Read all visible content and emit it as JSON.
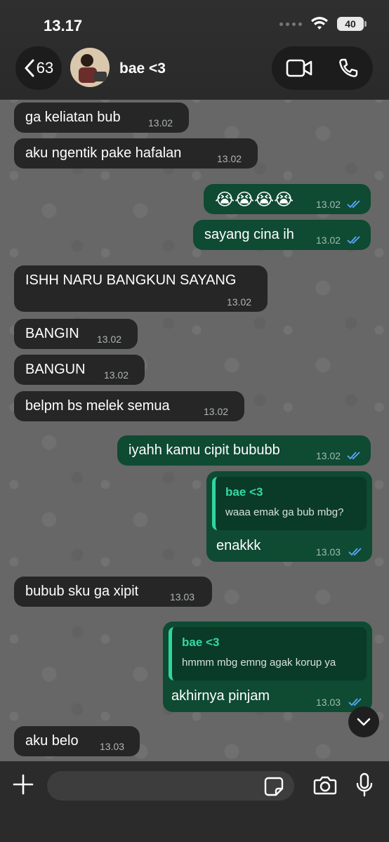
{
  "status": {
    "time": "13.17",
    "battery": "40"
  },
  "header": {
    "back_count": "63",
    "chat_name": "bae <3"
  },
  "messages": [
    {
      "text": "ga keliatan bub",
      "time": "13.02"
    },
    {
      "text": "aku ngentik pake hafalan",
      "time": "13.02"
    },
    {
      "text": "😭😭😭😭",
      "time": "13.02"
    },
    {
      "text": "sayang cina ih",
      "time": "13.02"
    },
    {
      "text": "ISHH NARU BANGKUN SAYANG",
      "time": "13.02"
    },
    {
      "text": "BANGIN",
      "time": "13.02"
    },
    {
      "text": "BANGUN",
      "time": "13.02"
    },
    {
      "text": "belpm bs melek semua",
      "time": "13.02"
    },
    {
      "text": "iyahh kamu cipit bububb",
      "time": "13.02"
    },
    {
      "text": "enakkk",
      "time": "13.03",
      "reply_name": "bae <3",
      "reply_text": "waaa emak ga bub mbg?"
    },
    {
      "text": "bubub sku ga xipit",
      "time": "13.03"
    },
    {
      "text": "akhirnya pinjam",
      "time": "13.03",
      "reply_name": "bae <3",
      "reply_text": "hmmm mbg emng agak korup ya"
    },
    {
      "text": "aku belo",
      "time": "13.03"
    }
  ],
  "icons": {
    "back": "chevron-left-icon",
    "video": "video-call-icon",
    "phone": "phone-icon",
    "plus": "plus-icon",
    "sticker": "sticker-icon",
    "camera": "camera-icon",
    "mic": "microphone-icon",
    "scroll": "chevron-down-icon"
  },
  "colors": {
    "incoming": "#262626",
    "outgoing": "#0f4a33",
    "reply_accent": "#33d9a4",
    "read_ticks": "#5aa8ff"
  }
}
